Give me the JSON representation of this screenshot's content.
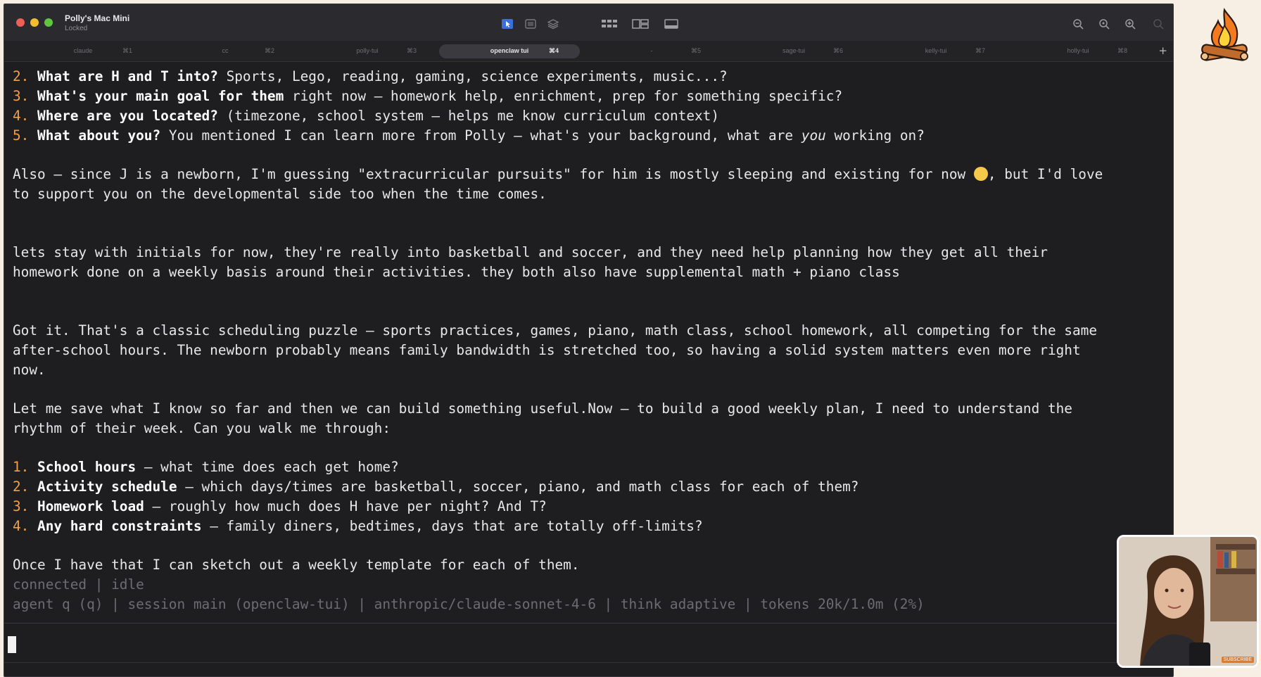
{
  "window": {
    "host_name": "Polly's Mac Mini",
    "host_status": "Locked"
  },
  "tabs": [
    {
      "name": "claude",
      "key": "⌘1",
      "active": false
    },
    {
      "name": "cc",
      "key": "⌘2",
      "active": false
    },
    {
      "name": "polly-tui",
      "key": "⌘3",
      "active": false
    },
    {
      "name": "openclaw tui",
      "key": "⌘4",
      "active": true
    },
    {
      "name": "-",
      "key": "⌘5",
      "active": false
    },
    {
      "name": "sage-tui",
      "key": "⌘6",
      "active": false
    },
    {
      "name": "kelly-tui",
      "key": "⌘7",
      "active": false
    },
    {
      "name": "holly-tui",
      "key": "⌘8",
      "active": false
    }
  ],
  "tab_plus": "+",
  "transcript": {
    "q2_num": "2.",
    "q2_bold": "What are H and T into?",
    "q2_rest": " Sports, Lego, reading, gaming, science experiments, music...?",
    "q3_num": "3.",
    "q3_bold": "What's your main goal for them",
    "q3_rest": " right now — homework help, enrichment, prep for something specific?",
    "q4_num": "4.",
    "q4_bold": "Where are you located?",
    "q4_rest": " (timezone, school system — helps me know curriculum context)",
    "q5_num": "5.",
    "q5_bold": "What about you?",
    "q5_rest": " You mentioned I can learn more from Polly — what's your background, what are ",
    "q5_em": "you",
    "q5_end": " working on?",
    "also_1a": "Also — since J is a newborn, I'm guessing \"extracurricular pursuits\" for him is mostly sleeping and existing for now ",
    "also_1b": ", but I'd love",
    "also_2": "to support you on the developmental side too when the time comes.",
    "user_1": "lets stay with initials for now, they're really into basketball and soccer, and they need help planning how they get all their",
    "user_2": "homework done on a weekly basis around their activities. they both also have supplemental math + piano class",
    "got_1": "Got it. That's a classic scheduling puzzle — sports practices, games, piano, math class, school homework, all competing for the same",
    "got_2": "after-school hours. The newborn probably means family bandwidth is stretched too, so having a solid system matters even more right",
    "got_3": "now.",
    "let_1": "Let me save what I know so far and then we can build something useful.Now — to build a good weekly plan, I need to understand the",
    "let_2": "rhythm of their week. Can you walk me through:",
    "s1_num": "1.",
    "s1_bold": "School hours",
    "s1_rest": " — what time does each get home?",
    "s2_num": "2.",
    "s2_bold": "Activity schedule",
    "s2_rest": " — which days/times are basketball, soccer, piano, and math class for each of them?",
    "s3_num": "3.",
    "s3_bold": "Homework load",
    "s3_rest": " — roughly how much does H have per night? And T?",
    "s4_num": "4.",
    "s4_bold": "Any hard constraints",
    "s4_rest": " — family diners, bedtimes, days that are totally off-limits?",
    "once": "Once I have that I can sketch out a weekly template for each of them."
  },
  "status": {
    "line1": "connected | idle",
    "line2": "agent q (q) | session main (openclaw-tui) | anthropic/claude-sonnet-4-6 | think adaptive | tokens 20k/1.0m (2%)"
  },
  "colors": {
    "accent_number": "#f0a04b",
    "terminal_bg": "#1e1e21"
  },
  "icons": [
    "close-dot",
    "minimize-dot",
    "maximize-dot",
    "cursor-select-icon",
    "screenshot-icon",
    "layers-icon",
    "grid-icon",
    "split-icon",
    "display-icon",
    "zoom-out-icon",
    "zoom-fit-icon",
    "zoom-in-icon",
    "zoom-disabled-icon",
    "campfire-logo"
  ],
  "watermark": "SUBSCRIBE"
}
